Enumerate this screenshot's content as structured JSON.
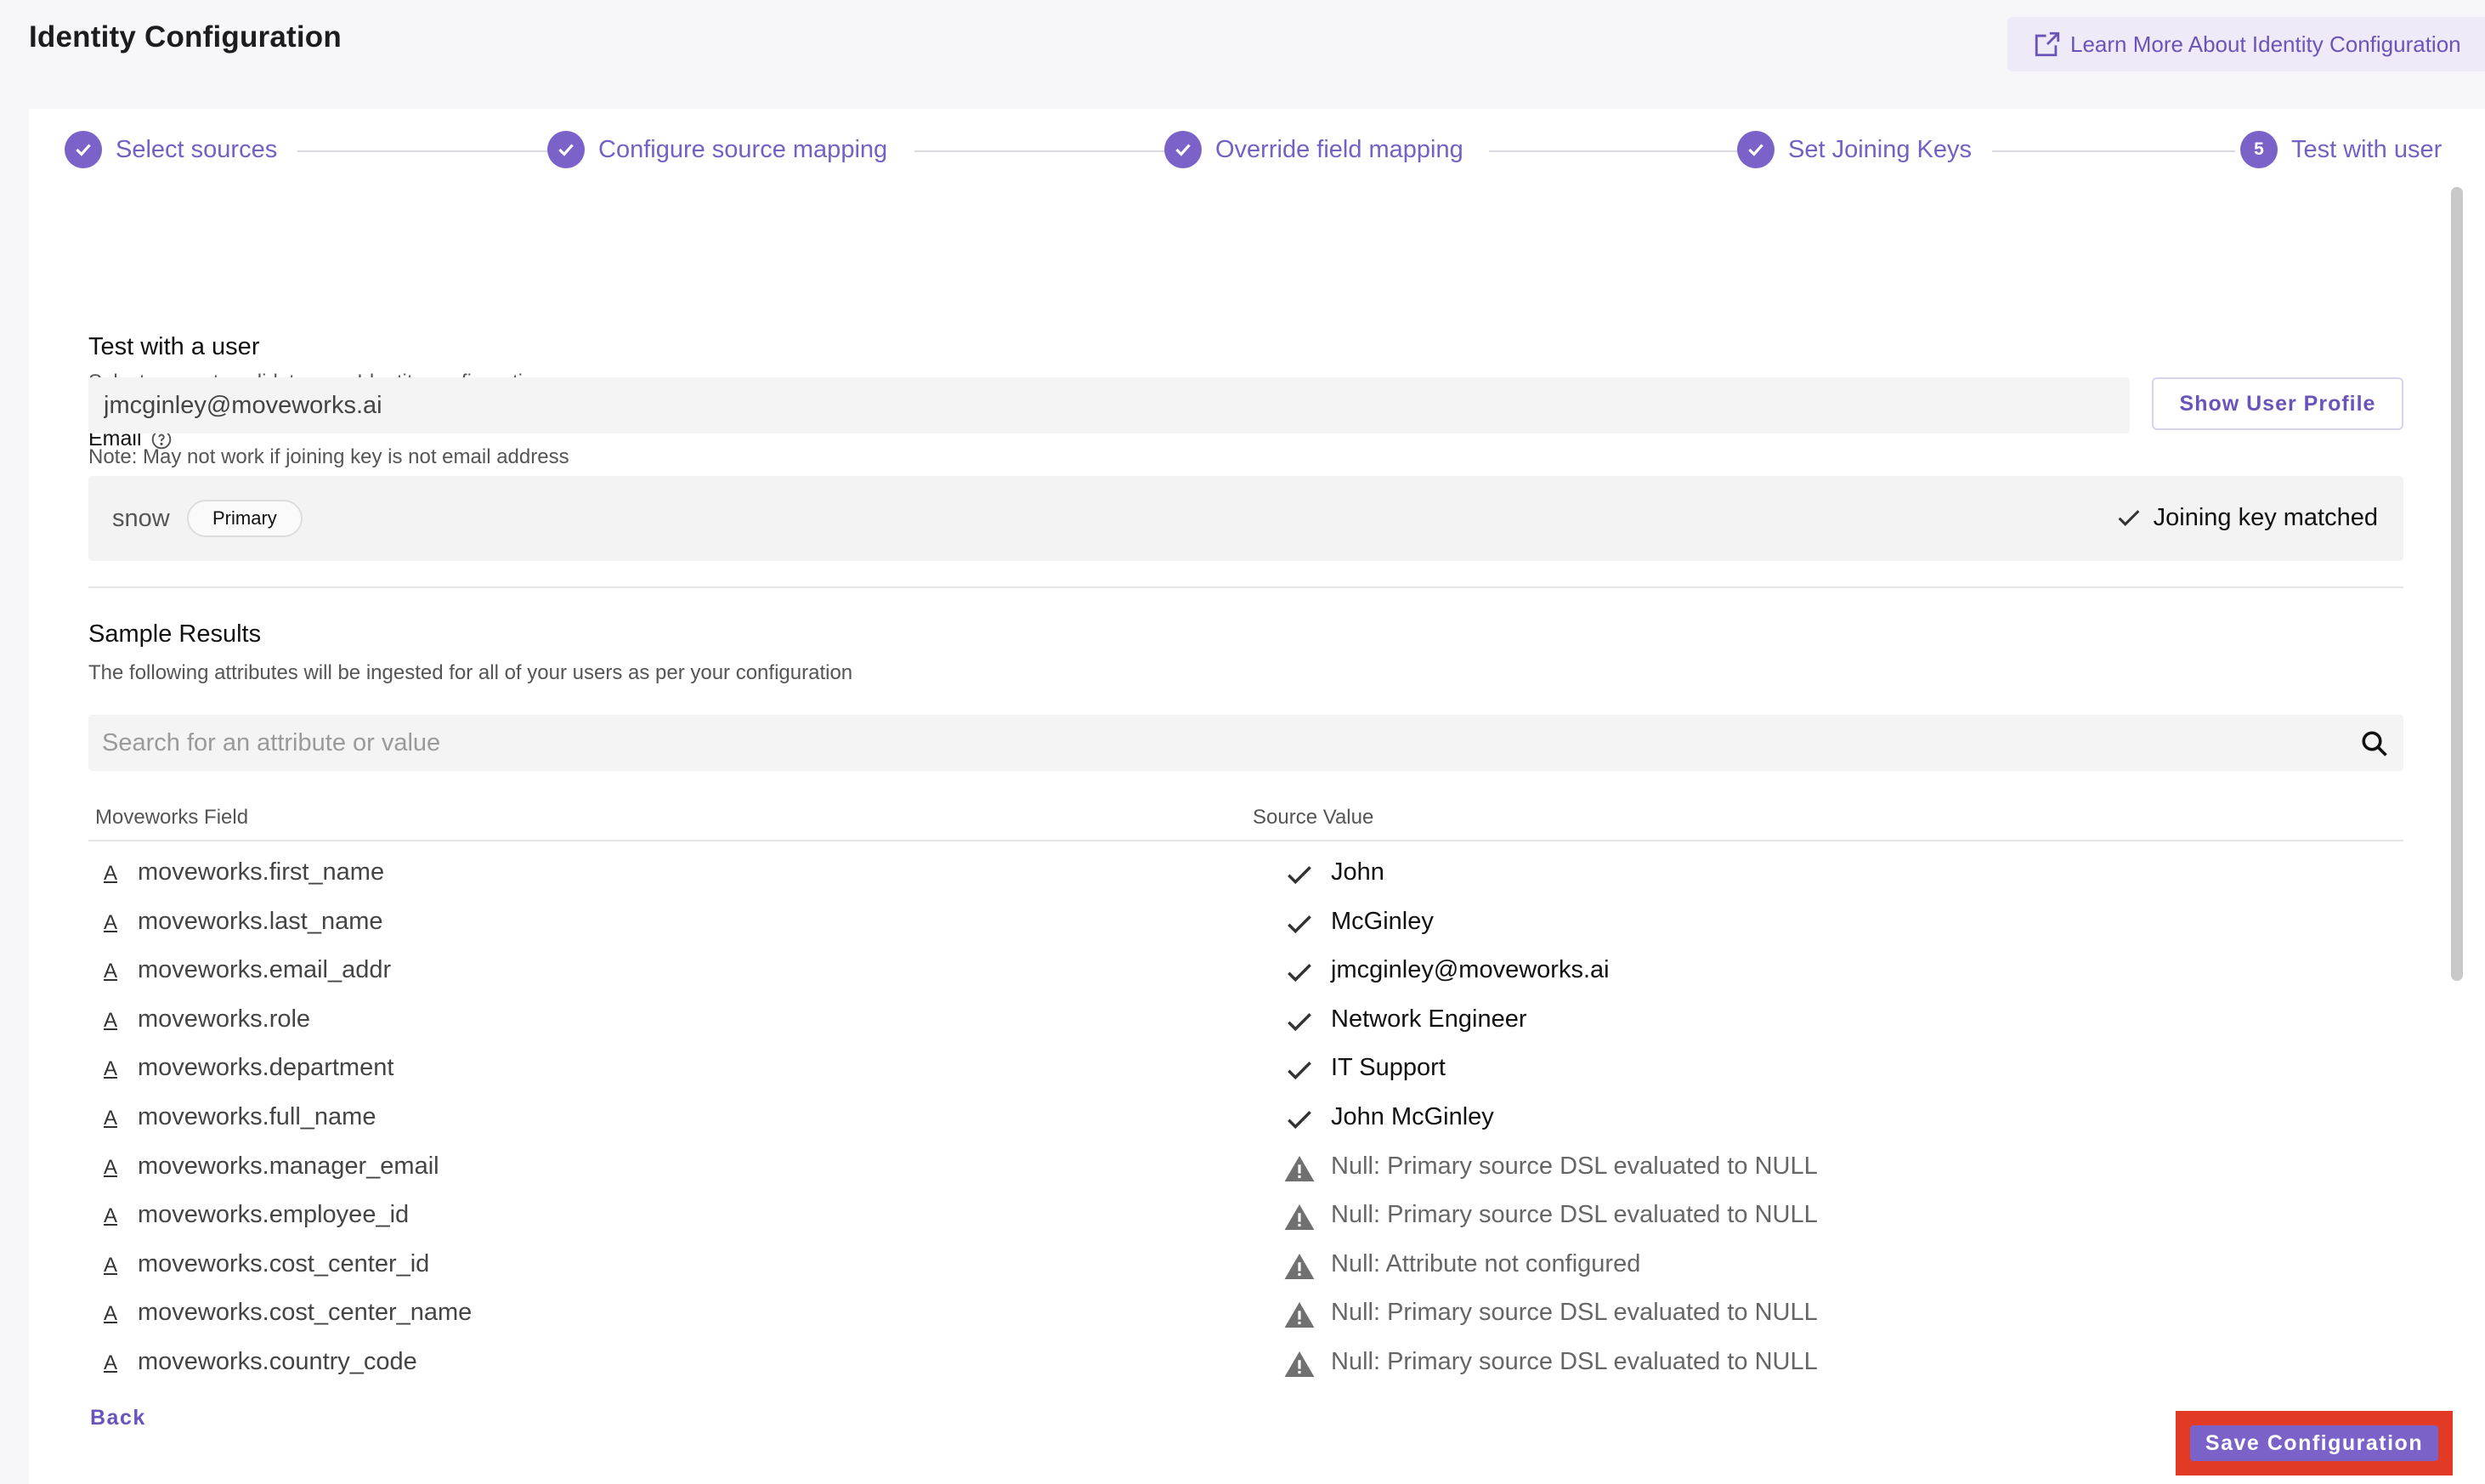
{
  "header": {
    "title": "Identity Configuration",
    "learn_more": "Learn More About Identity Configuration"
  },
  "stepper": {
    "steps": [
      {
        "label": "Select sources",
        "state": "done"
      },
      {
        "label": "Configure source mapping",
        "state": "done"
      },
      {
        "label": "Override field mapping",
        "state": "done"
      },
      {
        "label": "Set Joining Keys",
        "state": "done"
      },
      {
        "label": "Test with user",
        "state": "current",
        "number": "5"
      }
    ]
  },
  "test_section": {
    "title": "Test with a user",
    "subtitle": "Select a user to validate your Identity configuration",
    "email_label": "Email",
    "email_value": "jmcginley@moveworks.ai",
    "show_profile_label": "Show User Profile",
    "note": "Note: May not work if joining key is not email address"
  },
  "source": {
    "name": "snow",
    "chip": "Primary",
    "status": "Joining key matched"
  },
  "results": {
    "title": "Sample Results",
    "subtitle": "The following attributes will be ingested for all of your users as per your configuration",
    "search_placeholder": "Search for an attribute or value",
    "col_field": "Moveworks Field",
    "col_value": "Source Value",
    "type_glyph": "A",
    "rows": [
      {
        "field": "moveworks.first_name",
        "value": "John",
        "status": "ok"
      },
      {
        "field": "moveworks.last_name",
        "value": "McGinley",
        "status": "ok"
      },
      {
        "field": "moveworks.email_addr",
        "value": "jmcginley@moveworks.ai",
        "status": "ok"
      },
      {
        "field": "moveworks.role",
        "value": "Network Engineer",
        "status": "ok"
      },
      {
        "field": "moveworks.department",
        "value": "IT Support",
        "status": "ok"
      },
      {
        "field": "moveworks.full_name",
        "value": "John McGinley",
        "status": "ok"
      },
      {
        "field": "moveworks.manager_email",
        "value": "Null: Primary source DSL evaluated to NULL",
        "status": "warn"
      },
      {
        "field": "moveworks.employee_id",
        "value": "Null: Primary source DSL evaluated to NULL",
        "status": "warn"
      },
      {
        "field": "moveworks.cost_center_id",
        "value": "Null: Attribute not configured",
        "status": "warn"
      },
      {
        "field": "moveworks.cost_center_name",
        "value": "Null: Primary source DSL evaluated to NULL",
        "status": "warn"
      },
      {
        "field": "moveworks.country_code",
        "value": "Null: Primary source DSL evaluated to NULL",
        "status": "warn"
      }
    ]
  },
  "footer": {
    "back_label": "Back",
    "save_label": "Save Configuration"
  },
  "colors": {
    "accent": "#7b62c9",
    "highlight": "#e23a24"
  },
  "icons": {
    "learn_more": "external-link-icon",
    "step_done": "check-icon",
    "help": "help-circle-icon",
    "matched": "checkmark-icon",
    "search": "search-icon",
    "ok": "checkmark-icon",
    "warn": "warning-triangle-icon"
  }
}
